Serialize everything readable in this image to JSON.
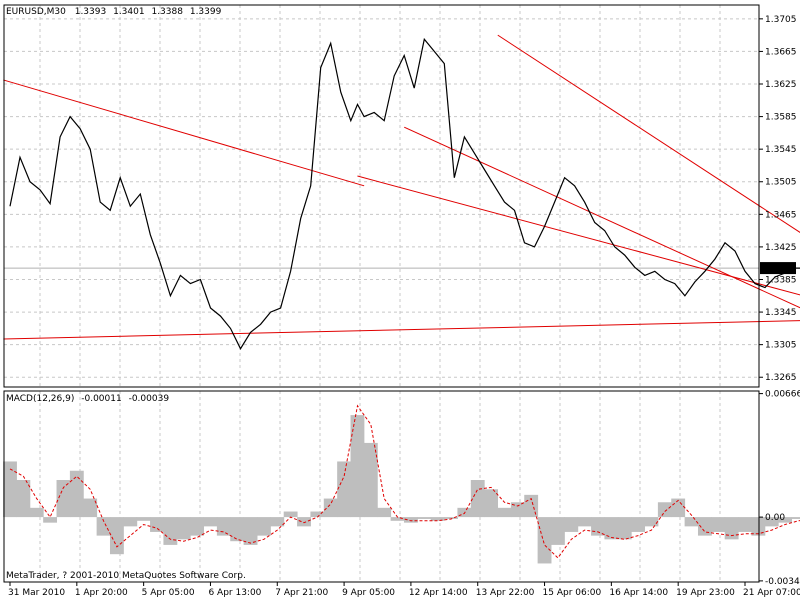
{
  "header": {
    "symbol": "EURUSD,M30",
    "open": "1.3393",
    "high": "1.3401",
    "low": "1.3388",
    "close": "1.3399"
  },
  "indicator": {
    "title": "MACD(12,26,9)",
    "main_value": "-0.00011",
    "signal_value": "-0.00039"
  },
  "copyright": "MetaTrader, ? 2001-2010 MetaQuotes Software Corp.",
  "chart_data": [
    {
      "type": "line",
      "name": "price",
      "ylim": [
        1.3253,
        1.3722
      ],
      "y_ticks": [
        "1.3705",
        "1.3665",
        "1.3625",
        "1.3585",
        "1.3545",
        "1.3505",
        "1.3465",
        "1.3425",
        "1.3385",
        "1.3345",
        "1.3305",
        "1.3265"
      ],
      "current_price": "1.3399",
      "x_ticks": [
        "31 Mar 2010",
        "1 Apr 20:00",
        "5 Apr 05:00",
        "6 Apr 13:00",
        "7 Apr 21:00",
        "9 Apr 05:00",
        "12 Apr 14:00",
        "13 Apr 22:00",
        "15 Apr 06:00",
        "16 Apr 14:00",
        "19 Apr 23:00",
        "21 Apr 07:00"
      ],
      "x_index": [
        0,
        1,
        2,
        3,
        4,
        5,
        6,
        7,
        8,
        9,
        10,
        11
      ],
      "x": [
        0,
        0.15,
        0.3,
        0.45,
        0.6,
        0.75,
        0.9,
        1.05,
        1.2,
        1.35,
        1.5,
        1.65,
        1.8,
        1.95,
        2.1,
        2.25,
        2.4,
        2.55,
        2.7,
        2.85,
        3.0,
        3.15,
        3.3,
        3.45,
        3.6,
        3.75,
        3.9,
        4.05,
        4.2,
        4.35,
        4.5,
        4.65,
        4.8,
        4.95,
        5.1,
        5.2,
        5.3,
        5.45,
        5.6,
        5.75,
        5.9,
        6.05,
        6.2,
        6.35,
        6.5,
        6.65,
        6.8,
        6.95,
        7.1,
        7.25,
        7.4,
        7.55,
        7.7,
        7.85,
        8.0,
        8.15,
        8.3,
        8.45,
        8.6,
        8.75,
        8.9,
        9.05,
        9.2,
        9.35,
        9.5,
        9.65,
        9.8,
        9.95,
        10.1,
        10.25,
        10.4,
        10.55,
        10.7,
        10.85,
        11.0,
        11.15,
        11.3,
        11.45,
        11.6,
        11.75,
        11.9,
        12.0
      ],
      "y": [
        1.3475,
        1.3535,
        1.3505,
        1.3495,
        1.3478,
        1.356,
        1.3585,
        1.357,
        1.3545,
        1.348,
        1.347,
        1.351,
        1.3475,
        1.349,
        1.344,
        1.3405,
        1.3365,
        1.339,
        1.338,
        1.3385,
        1.335,
        1.334,
        1.3325,
        1.33,
        1.332,
        1.333,
        1.3345,
        1.335,
        1.3395,
        1.346,
        1.35,
        1.3645,
        1.3675,
        1.3615,
        1.358,
        1.36,
        1.3585,
        1.359,
        1.358,
        1.3635,
        1.366,
        1.362,
        1.368,
        1.3665,
        1.365,
        1.351,
        1.356,
        1.354,
        1.352,
        1.35,
        1.348,
        1.347,
        1.343,
        1.3425,
        1.345,
        1.348,
        1.351,
        1.35,
        1.348,
        1.3455,
        1.3445,
        1.3425,
        1.3415,
        1.34,
        1.339,
        1.3395,
        1.3385,
        1.338,
        1.3365,
        1.3382,
        1.3395,
        1.341,
        1.343,
        1.342,
        1.3395,
        1.338,
        1.3375,
        1.3388,
        1.3393,
        1.3399,
        1.3399,
        1.3399
      ],
      "trend_lines": [
        {
          "x": [
            -0.1,
            5.3
          ],
          "y": [
            1.363,
            1.35
          ]
        },
        {
          "x": [
            -0.1,
            12.1
          ],
          "y": [
            1.3312,
            1.3335
          ]
        },
        {
          "x": [
            5.9,
            12.1
          ],
          "y": [
            1.3572,
            1.334
          ]
        },
        {
          "x": [
            7.3,
            12.1
          ],
          "y": [
            1.3685,
            1.3428
          ]
        },
        {
          "x": [
            5.2,
            12.1
          ],
          "y": [
            1.3512,
            1.336
          ]
        }
      ]
    },
    {
      "type": "bar",
      "name": "MACD",
      "ylim": [
        -0.0035,
        0.0068
      ],
      "y_ticks": [
        "0.00666",
        "0.00",
        "-0.00344"
      ],
      "x": [
        0,
        0.2,
        0.4,
        0.6,
        0.8,
        1.0,
        1.2,
        1.4,
        1.6,
        1.8,
        2.0,
        2.2,
        2.4,
        2.6,
        2.8,
        3.0,
        3.2,
        3.4,
        3.6,
        3.8,
        4.0,
        4.2,
        4.4,
        4.6,
        4.8,
        5.0,
        5.2,
        5.4,
        5.6,
        5.8,
        6.0,
        6.2,
        6.4,
        6.6,
        6.8,
        7.0,
        7.2,
        7.4,
        7.6,
        7.8,
        8.0,
        8.2,
        8.4,
        8.6,
        8.8,
        9.0,
        9.2,
        9.4,
        9.6,
        9.8,
        10.0,
        10.2,
        10.4,
        10.6,
        10.8,
        11.0,
        11.2,
        11.4,
        11.6,
        11.8,
        12.0
      ],
      "values": [
        0.003,
        0.002,
        0.0005,
        -0.0003,
        0.002,
        0.0025,
        0.001,
        -0.001,
        -0.002,
        -0.0005,
        -0.0002,
        -0.0008,
        -0.0015,
        -0.0012,
        -0.001,
        -0.0005,
        -0.001,
        -0.0013,
        -0.0015,
        -0.001,
        -0.0005,
        0.0003,
        -0.0005,
        0.0003,
        0.001,
        0.003,
        0.0055,
        0.004,
        0.0005,
        -0.0002,
        -0.0003,
        -0.0001,
        -0.0002,
        -0.0001,
        0.0005,
        0.002,
        0.0015,
        0.0005,
        0.0008,
        0.0012,
        -0.0025,
        -0.0015,
        -0.0008,
        -0.0005,
        -0.001,
        -0.0012,
        -0.0012,
        -0.0008,
        -0.0005,
        0.0008,
        0.001,
        -0.0005,
        -0.001,
        -0.0008,
        -0.0012,
        -0.0008,
        -0.001,
        -0.0005,
        -0.0003,
        -0.0001,
        -0.0001
      ],
      "signal": [
        0.0026,
        0.0022,
        0.001,
        0.0,
        0.0016,
        0.0022,
        0.0015,
        -0.0002,
        -0.0016,
        -0.001,
        -0.0004,
        -0.0006,
        -0.0012,
        -0.0013,
        -0.0011,
        -0.0007,
        -0.0008,
        -0.0012,
        -0.0014,
        -0.0012,
        -0.0007,
        0.0,
        -0.0003,
        0.0,
        0.0007,
        0.0022,
        0.006,
        0.005,
        0.001,
        0.0,
        -0.0002,
        -0.0002,
        -0.0002,
        -0.0001,
        0.0002,
        0.0015,
        0.0016,
        0.0008,
        0.0006,
        0.001,
        -0.0015,
        -0.0022,
        -0.0012,
        -0.0007,
        -0.0008,
        -0.0011,
        -0.0012,
        -0.001,
        -0.0007,
        0.0003,
        0.0009,
        0.0001,
        -0.0008,
        -0.0009,
        -0.001,
        -0.0009,
        -0.0009,
        -0.0007,
        -0.0004,
        -0.0002,
        -0.0001
      ]
    }
  ]
}
